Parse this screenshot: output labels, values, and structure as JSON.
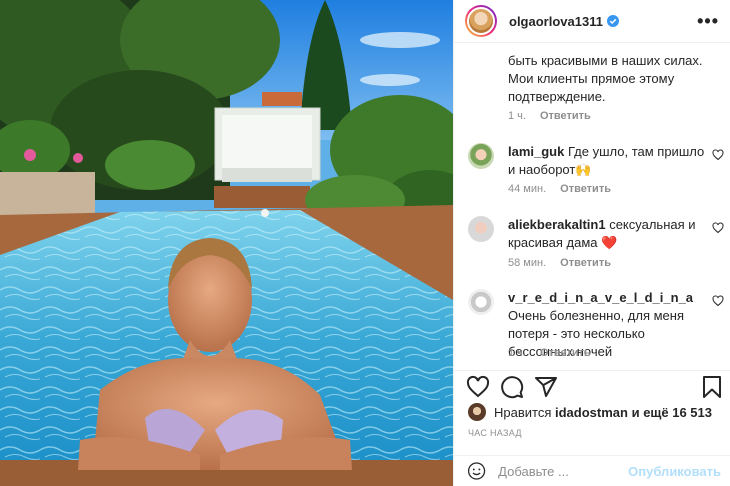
{
  "post": {
    "username": "olgaorlova1311",
    "more_label": "•••"
  },
  "caption_tail": {
    "text": "быть красивыми в наших силах. Мои клиенты прямое этому подтверждение.",
    "time": "1 ч.",
    "reply": "Ответить"
  },
  "comments": [
    {
      "username": "lami_guk",
      "text": "Где ушло, там пришло и наоборот🙌",
      "time": "44 мин.",
      "reply": "Ответить"
    },
    {
      "username": "aliekberakaltin1",
      "text": "сексуальная и красивая дама ❤️",
      "time": "58 мин.",
      "reply": "Ответить"
    },
    {
      "username": "v_r_e_d_i_n_a_v_e_l_d_i_n_a",
      "text": "Очень болезненно, для меня потеря - это несколько бессонных ночей",
      "time": "1 ч.",
      "reply": "Ответить"
    }
  ],
  "likes": {
    "prefix": "Нравится",
    "user": "idadostman",
    "suffix": "и ещё 16 513"
  },
  "post_time": "час назад",
  "add_comment": {
    "placeholder": "Добавьте ...",
    "publish_label": "Опубликовать"
  },
  "colors": {
    "verified": "#3897f0",
    "link_muted": "#b2dffc",
    "meta_text": "#8e8e8e",
    "heart_red": "#e0245e"
  },
  "icons": [
    "heart-icon",
    "comment-icon",
    "share-icon",
    "bookmark-icon",
    "emoji-icon",
    "verified-badge-icon",
    "more-icon"
  ]
}
